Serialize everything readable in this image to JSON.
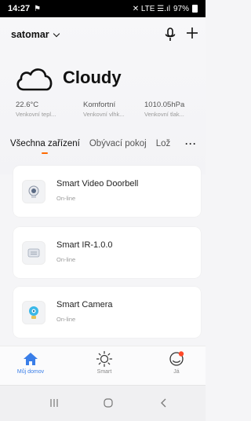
{
  "status_bar": {
    "time": "14:27",
    "flag": "⚑",
    "indicators": "✕ LTE ☰.ıl",
    "battery": "97%"
  },
  "header": {
    "home_name": "satomar"
  },
  "weather": {
    "condition": "Cloudy",
    "stats": [
      {
        "value": "22.6°C",
        "label": "Venkovní tepl..."
      },
      {
        "value": "Komfortní",
        "label": "Venkovní vlhk..."
      },
      {
        "value": "1010.05hPa",
        "label": "Venkovní tlak..."
      }
    ]
  },
  "tabs": [
    {
      "label": "Všechna zařízení"
    },
    {
      "label": "Obývací pokoj"
    },
    {
      "label": "Lož"
    }
  ],
  "more_label": "···",
  "devices": [
    {
      "name": "Smart Video Doorbell",
      "status": "On-line",
      "icon": "doorbell-camera-icon"
    },
    {
      "name": "Smart IR-1.0.0",
      "status": "On-line",
      "icon": "ir-remote-icon"
    },
    {
      "name": "Smart  Camera",
      "status": "On-line",
      "icon": "camera-icon"
    }
  ],
  "bottom_nav": [
    {
      "label": "Můj domov",
      "icon": "home-icon",
      "active": true
    },
    {
      "label": "Smart",
      "icon": "sun-icon",
      "active": false
    },
    {
      "label": "Já",
      "icon": "profile-icon",
      "active": false
    }
  ],
  "colors": {
    "accent": "#3a7ee8",
    "tab_indicator": "#ff6a00",
    "notification": "#ff4a2a"
  }
}
